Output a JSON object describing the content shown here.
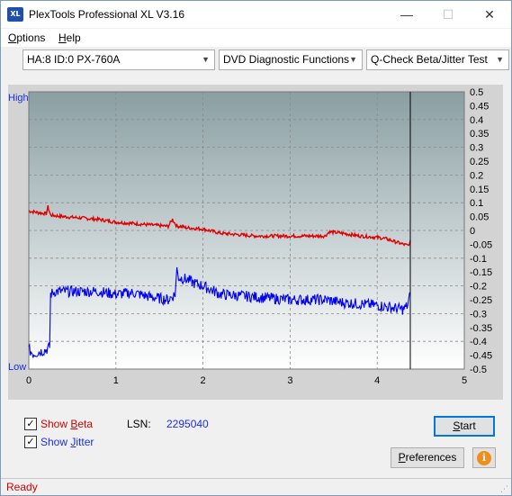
{
  "window": {
    "app_icon_text": "XL",
    "title": "PlexTools Professional XL V3.16",
    "min_glyph": "—",
    "max_glyph": "☐",
    "close_glyph": "✕"
  },
  "menu": {
    "options_hot": "O",
    "options_rest": "ptions",
    "help_hot": "H",
    "help_rest": "elp"
  },
  "toolbar": {
    "drive": "HA:8 ID:0  PX-760A",
    "function": "DVD Diagnostic Functions",
    "test": "Q-Check Beta/Jitter Test",
    "arrow_glyph": "▼"
  },
  "chart_data": {
    "type": "line",
    "x_range": [
      0,
      5
    ],
    "x_ticks": [
      "0",
      "1",
      "2",
      "3",
      "4",
      "5"
    ],
    "left_axis_labels": {
      "top": "High",
      "bottom": "Low"
    },
    "right_range": [
      -0.5,
      0.5
    ],
    "right_ticks": [
      "0.5",
      "0.45",
      "0.4",
      "0.35",
      "0.3",
      "0.25",
      "0.2",
      "0.15",
      "0.1",
      "0.05",
      "0",
      "-0.05",
      "-0.1",
      "-0.15",
      "-0.2",
      "-0.25",
      "-0.3",
      "-0.35",
      "-0.4",
      "-0.45",
      "-0.5"
    ],
    "grid": true,
    "end_marker_x": 4.38,
    "series": [
      {
        "color": "#e00000",
        "x": [
          0.0,
          0.2,
          0.22,
          0.25,
          0.4,
          0.6,
          0.8,
          1.0,
          1.2,
          1.4,
          1.6,
          1.65,
          1.7,
          1.75,
          1.8,
          2.0,
          2.2,
          2.4,
          2.6,
          2.8,
          3.0,
          3.2,
          3.4,
          3.45,
          3.6,
          3.8,
          4.0,
          4.1,
          4.2,
          4.3,
          4.36,
          4.38
        ],
        "y": [
          0.07,
          0.06,
          0.085,
          0.055,
          0.05,
          0.045,
          0.04,
          0.03,
          0.025,
          0.02,
          0.015,
          0.04,
          0.015,
          0.015,
          0.01,
          0.005,
          -0.01,
          -0.015,
          -0.02,
          -0.02,
          -0.02,
          -0.02,
          -0.02,
          -0.005,
          -0.01,
          -0.02,
          -0.025,
          -0.03,
          -0.04,
          -0.05,
          -0.055,
          -0.035
        ]
      },
      {
        "color": "#0000ee",
        "x": [
          0.0,
          0.05,
          0.1,
          0.15,
          0.2,
          0.24,
          0.25,
          0.3,
          0.4,
          0.6,
          0.8,
          1.0,
          1.2,
          1.4,
          1.6,
          1.68,
          1.7,
          1.72,
          1.8,
          1.9,
          2.0,
          2.1,
          2.2,
          2.4,
          2.6,
          2.8,
          3.0,
          3.2,
          3.4,
          3.6,
          3.8,
          4.0,
          4.1,
          4.2,
          4.3,
          4.35,
          4.38
        ],
        "y": [
          -0.43,
          -0.445,
          -0.44,
          -0.435,
          -0.43,
          -0.42,
          -0.23,
          -0.22,
          -0.22,
          -0.22,
          -0.22,
          -0.23,
          -0.225,
          -0.24,
          -0.25,
          -0.23,
          -0.14,
          -0.17,
          -0.175,
          -0.19,
          -0.2,
          -0.215,
          -0.23,
          -0.235,
          -0.24,
          -0.245,
          -0.25,
          -0.25,
          -0.25,
          -0.26,
          -0.265,
          -0.27,
          -0.275,
          -0.28,
          -0.285,
          -0.27,
          -0.23
        ]
      }
    ]
  },
  "controls": {
    "show_beta_pre": "Show ",
    "show_beta_hot": "B",
    "show_beta_rest": "eta",
    "show_jitter_pre": "Show ",
    "show_jitter_hot": "J",
    "show_jitter_rest": "itter",
    "check_glyph": "✓",
    "lsn_label": "LSN:",
    "lsn_value": "2295040",
    "start_hot": "S",
    "start_rest": "tart",
    "prefs_hot": "P",
    "prefs_rest": "references",
    "info_glyph": "i"
  },
  "colors": {
    "plot_top": "#8a9fa3",
    "plot_bottom": "#ffffff",
    "beta": "#e00000",
    "jitter": "#0000ee",
    "axis_text_left": "#1a2ee0"
  },
  "status": {
    "text": "Ready"
  }
}
